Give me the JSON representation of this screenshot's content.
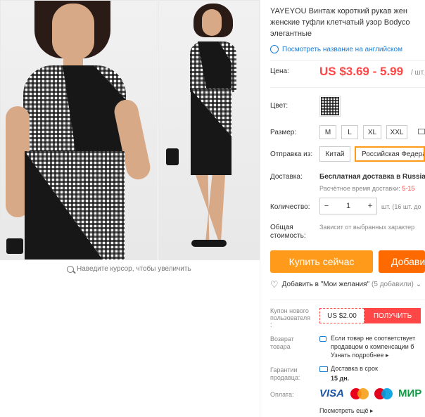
{
  "gallery": {
    "zoom_hint": "Наведите курсор, чтобы увеличить"
  },
  "product": {
    "title_lines": [
      "YAYEYOU Винтаж короткий рукав жен",
      "женские туфли клетчатый узор Bodyco",
      "элегантные"
    ],
    "translate_link": "Посмотреть название на английском",
    "price_label": "Цена:",
    "price": "US $3.69 - 5.99",
    "price_unit": "/ шт.",
    "color_label": "Цвет:",
    "size_label": "Размер:",
    "sizes": [
      "M",
      "L",
      "XL",
      "XXL"
    ],
    "ship_from_label": "Отправка из:",
    "ship_from_options": [
      "Китай",
      "Российская Федера"
    ],
    "delivery_label": "Доставка:",
    "delivery_value": "Бесплатная доставка в Russian",
    "delivery_time_label": "Расчётное время доставки:",
    "delivery_time_value": "5-15",
    "quantity_label": "Количество:",
    "quantity_value": "1",
    "quantity_minus": "−",
    "quantity_plus": "+",
    "quantity_stock": "шт. (16 шт. до",
    "total_label_1": "Общая",
    "total_label_2": "стоимость:",
    "total_value": "Зависит от выбранных характер",
    "buy_now": "Купить сейчас",
    "add_to_cart": "Добави",
    "wishlist_text": "Добавить в \"Мои желания\"",
    "wishlist_count": "(5 добавили)",
    "coupon_label": [
      "Купон нового",
      "пользователя",
      ":"
    ],
    "coupon_value": "US $2.00",
    "coupon_button": "ПОЛУЧИТЬ",
    "return_label": [
      "Возврат",
      "товара"
    ],
    "return_text_1": "Если товар не соответствует",
    "return_text_2": "продавцом о компенсации б",
    "return_more": "Узнать подробнее",
    "guarantee_label": [
      "Гарантии",
      "продавца:"
    ],
    "guarantee_text": "Доставка в срок",
    "guarantee_days": "15 дн.",
    "payment_label": "Оплата:",
    "payment_methods": [
      "VISA",
      "MasterCard",
      "Maestro",
      "МИР"
    ],
    "payment_more": "Посмотреть ещё"
  },
  "colors": {
    "accent": "#ff4747",
    "button_orange": "#ff9a1b",
    "link_blue": "#1b7ed5"
  }
}
